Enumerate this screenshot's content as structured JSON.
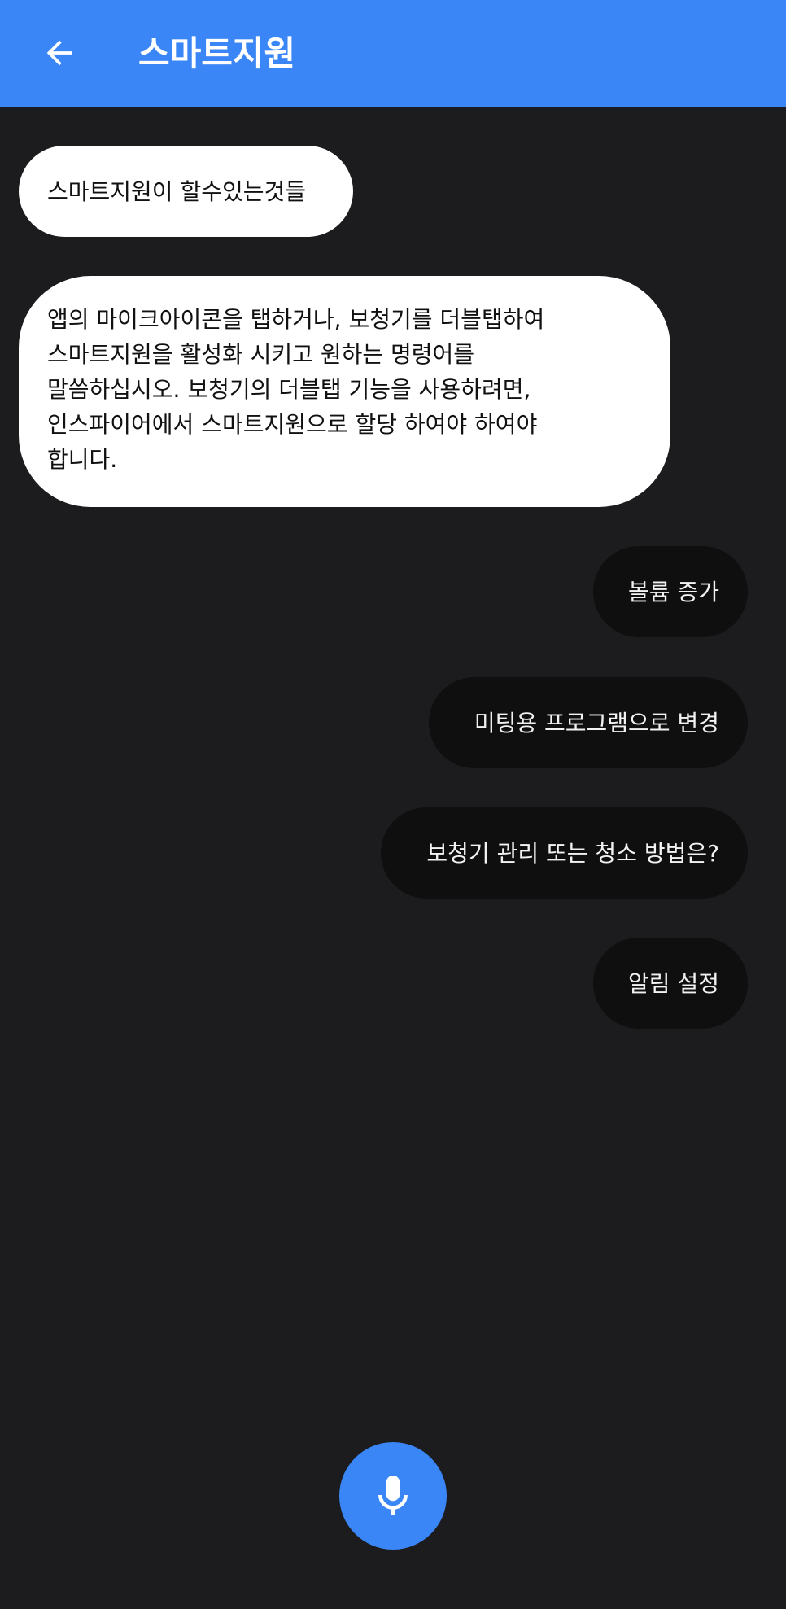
{
  "appbar": {
    "title": "스마트지원",
    "back_icon": "arrow-left-icon",
    "background": "#3b86f6"
  },
  "messages": {
    "bot_intro": "스마트지원이 할수있는것들",
    "bot_help_lines": [
      "앱의 마이크아이콘을 탭하거나, 보청기를 더블탭하여",
      "스마트지원을 활성화 시키고 원하는 명령어를",
      "말씀하십시오. 보청기의 더블탭 기능을 사용하려면,",
      "인스파이어에서 스마트지원으로 할당 하여야 하여야",
      "합니다."
    ],
    "suggestions": [
      "볼륨 증가",
      "미팅용 프로그램으로 변경",
      "보청기 관리 또는 청소 방법은?",
      "알림 설정"
    ]
  },
  "mic": {
    "icon": "microphone-icon",
    "color": "#3b86f6"
  }
}
